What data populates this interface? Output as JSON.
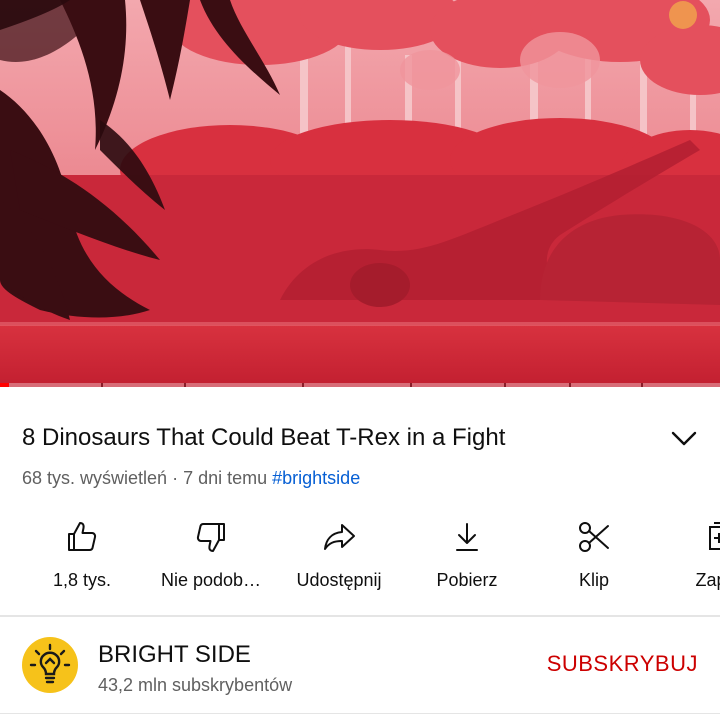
{
  "player": {
    "progress_fraction": 0.012,
    "accent_color": "#ff0000",
    "chapter_markers_fraction": [
      0.14,
      0.255,
      0.42,
      0.57,
      0.7,
      0.79,
      0.89
    ]
  },
  "video": {
    "title": "8 Dinosaurs That Could Beat T-Rex in a Fight",
    "views": "68 tys. wyświetleń",
    "separator": " · ",
    "age": "7 dni temu",
    "hashtag": "#brightside"
  },
  "actions": [
    {
      "label": "1,8 tys.",
      "icon": "thumb-up-icon"
    },
    {
      "label": "Nie podob…",
      "icon": "thumb-down-icon"
    },
    {
      "label": "Udostępnij",
      "icon": "share-icon"
    },
    {
      "label": "Pobierz",
      "icon": "download-icon"
    },
    {
      "label": "Klip",
      "icon": "scissors-icon"
    },
    {
      "label": "Zapisz",
      "icon": "save-playlist-icon"
    }
  ],
  "channel": {
    "name": "BRIGHT SIDE",
    "subscribers": "43,2 mln subskrybentów",
    "subscribe_label": "SUBSKRYBUJ",
    "subscribe_color": "#cc0000",
    "avatar_icon": "lightbulb-icon"
  }
}
